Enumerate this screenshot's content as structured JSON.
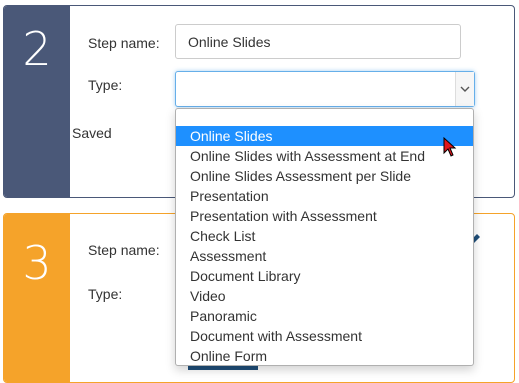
{
  "steps": [
    {
      "number": "2",
      "step_name_label": "Step name:",
      "step_name_value": "Online Slides",
      "type_label": "Type:",
      "type_value": "",
      "status": "Saved"
    },
    {
      "number": "3",
      "step_name_label": "Step name:",
      "type_label": "Type:"
    }
  ],
  "dropdown": {
    "selected_index": 0,
    "options": [
      "Online Slides",
      "Online Slides with Assessment at End",
      "Online Slides Assessment per Slide",
      "Presentation",
      "Presentation with Assessment",
      "Check List",
      "Assessment",
      "Document Library",
      "Video",
      "Panoramic",
      "Document with Assessment",
      "Online Form"
    ]
  },
  "colors": {
    "step2_accent": "#4a5878",
    "step3_accent": "#f5a32a",
    "highlight": "#1e90ff"
  },
  "icons": [
    "chevron-down-icon",
    "pencil-icon",
    "mouse-cursor-icon"
  ]
}
